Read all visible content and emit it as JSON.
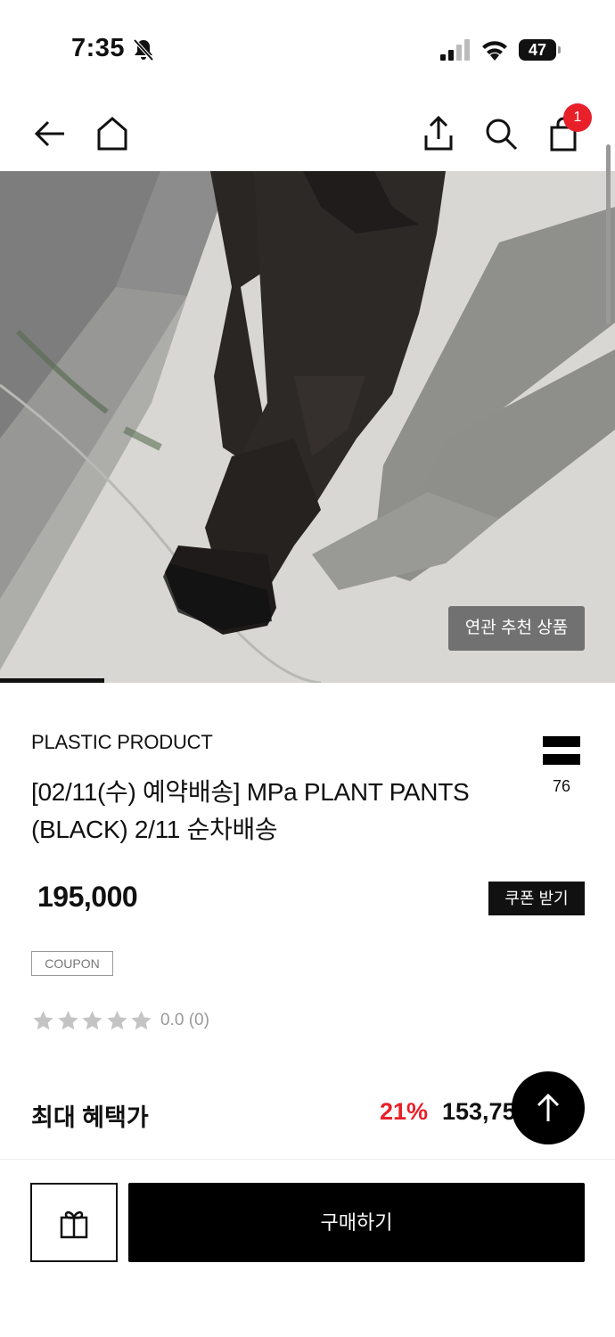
{
  "status_bar": {
    "time": "7:35",
    "battery": "47",
    "icons": [
      "bell-slash-icon",
      "cellular-signal-icon",
      "wifi-icon",
      "battery-icon"
    ]
  },
  "nav": {
    "icons": [
      "arrow-left-icon",
      "home-icon",
      "share-icon",
      "search-icon",
      "shopping-bag-icon"
    ],
    "cart_count": "1"
  },
  "hero": {
    "related_label": "연관 추천 상품",
    "image_progress": 0.17
  },
  "product": {
    "brand": "PLASTIC PRODUCT",
    "title": "[02/11(수) 예약배송]  MPa PLANT PANTS (BLACK) 2/11 순차배송",
    "like_count": "76",
    "price": "195,000",
    "coupon_button": "쿠폰 받기",
    "coupon_tag": "COUPON",
    "rating": 0.0,
    "rating_text": "0.0 (0)"
  },
  "benefit": {
    "label": "최대 혜택가",
    "discount": "21%",
    "price": "153,75"
  },
  "bottom": {
    "buy_label": "구매하기"
  },
  "colors": {
    "accent_red": "#e8202a",
    "primary_black": "#000000",
    "star_gray": "#c4c4c4"
  }
}
